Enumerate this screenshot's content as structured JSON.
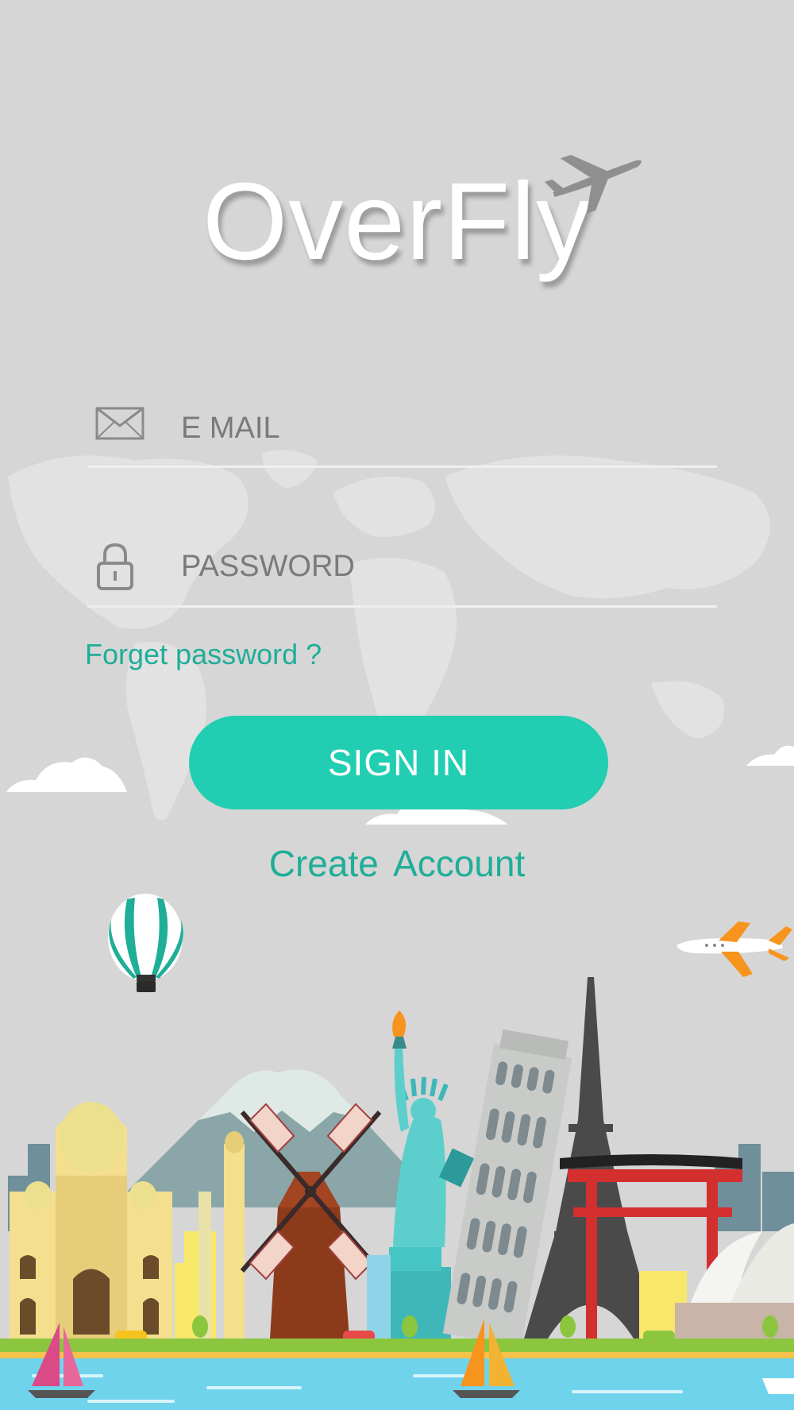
{
  "app": {
    "logo_text": "OverFly"
  },
  "form": {
    "email_placeholder": "E MAIL",
    "password_placeholder": "PASSWORD",
    "forgot_label": "Forget password ?",
    "signin_label": "SIGN IN",
    "create_label": "Create  Account"
  },
  "colors": {
    "background": "#d6d6d6",
    "accent": "#22ceb1",
    "link": "#1fae98",
    "sea": "#6fd3ec",
    "grass": "#8cc63f"
  },
  "icons": {
    "email": "envelope-icon",
    "password": "lock-icon",
    "logo_plane": "airplane-icon"
  }
}
